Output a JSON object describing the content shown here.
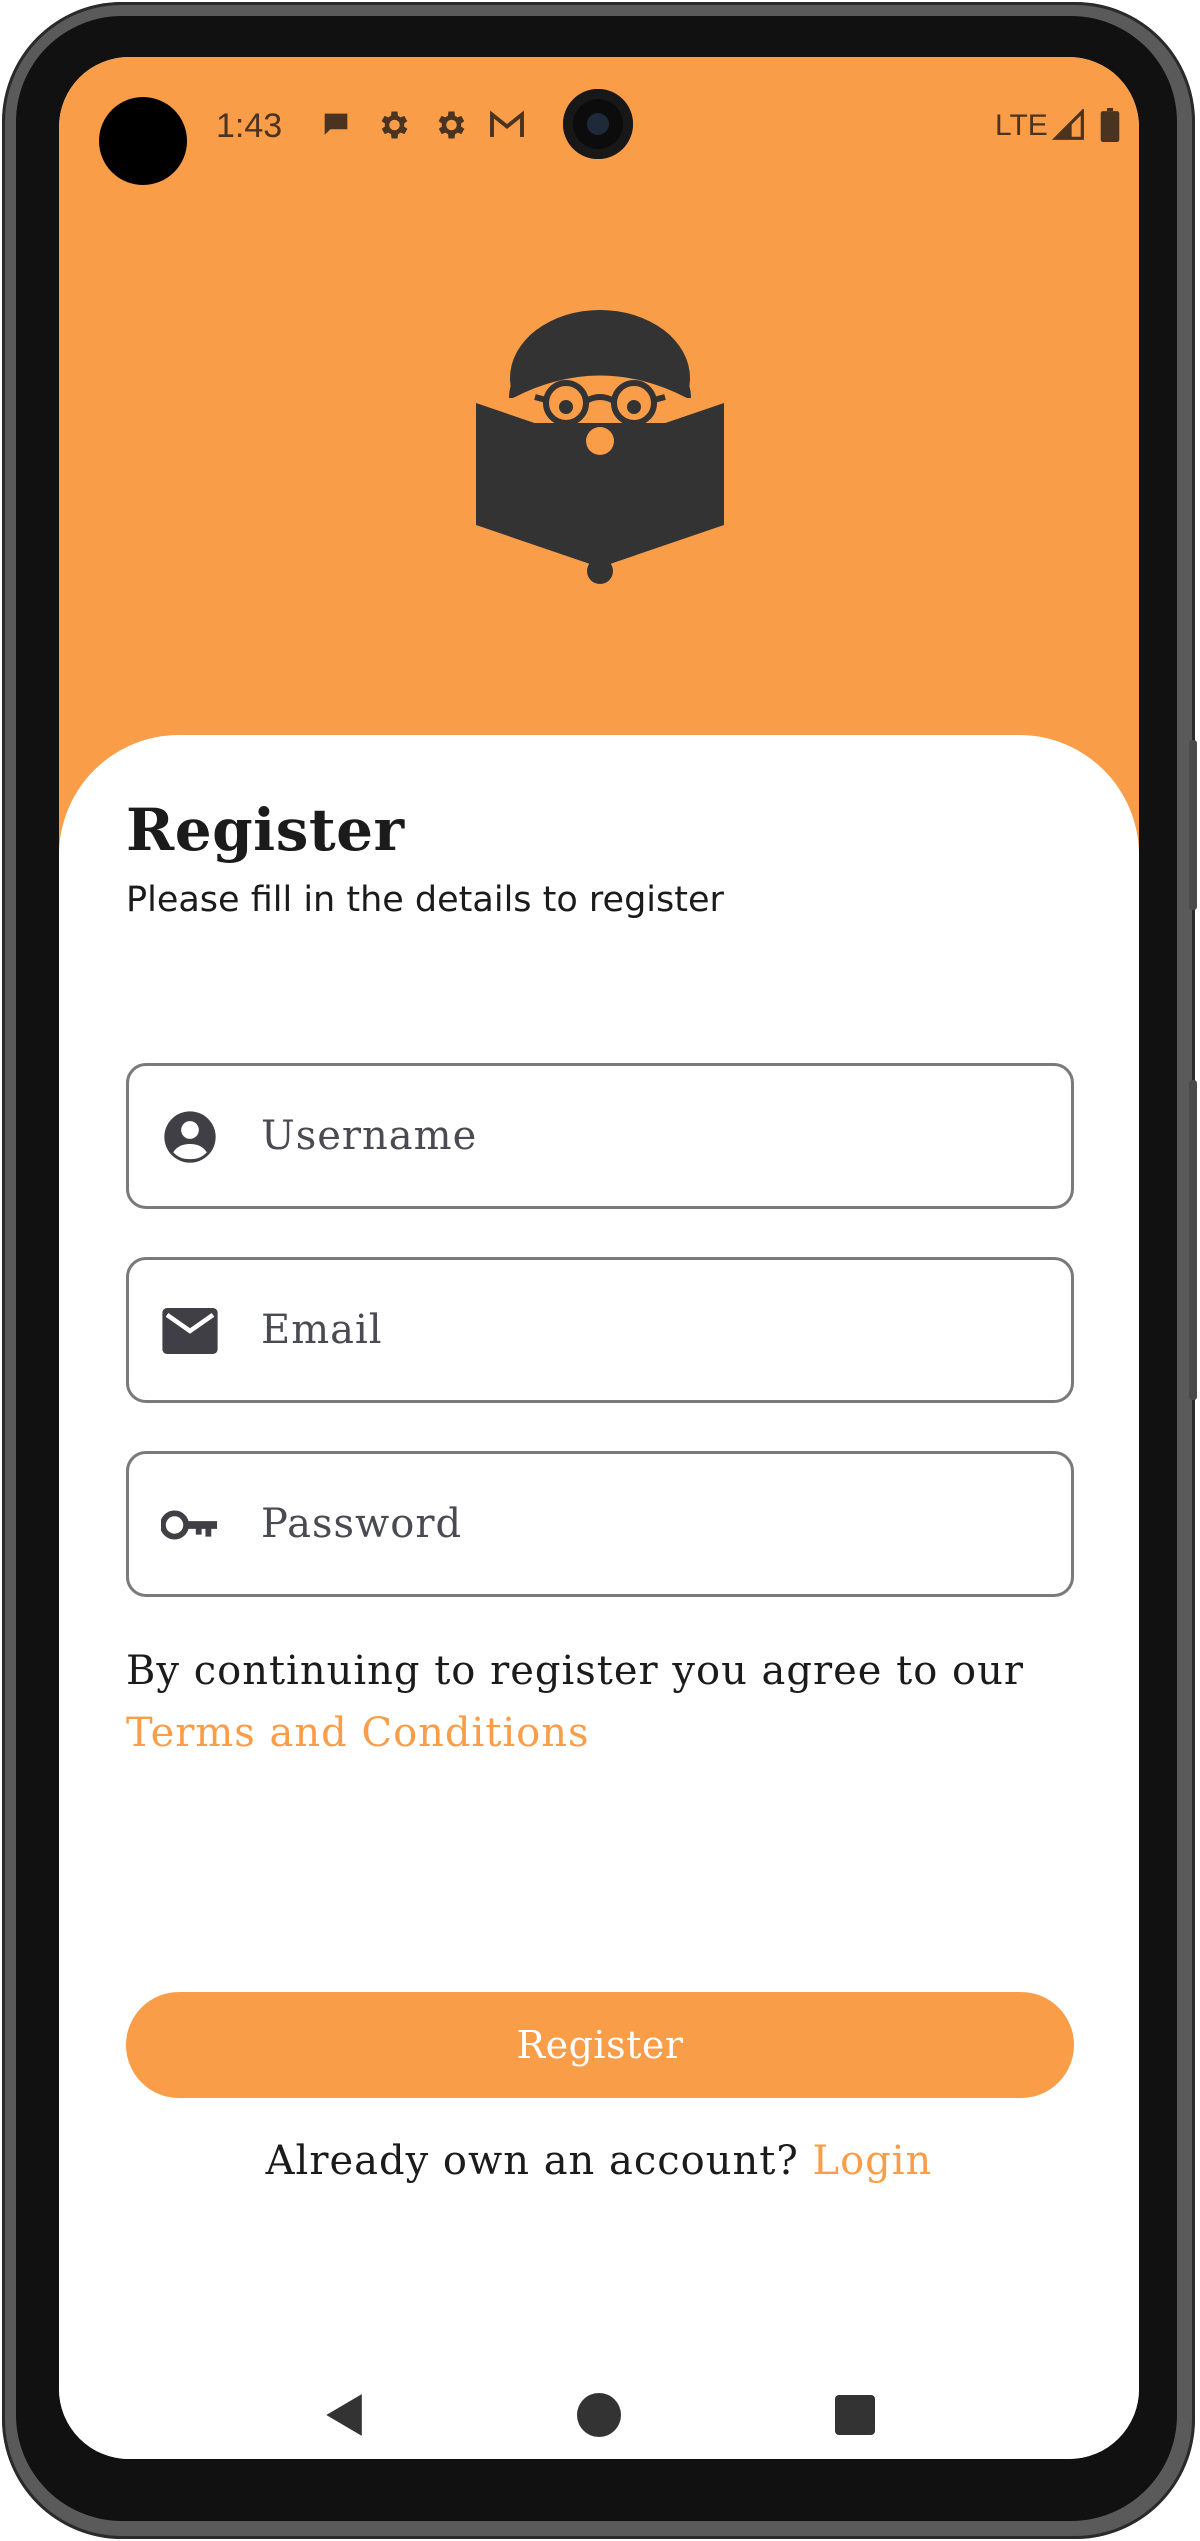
{
  "status_bar": {
    "time": "1:43",
    "network": "LTE",
    "icons": [
      "chat-bubble-icon",
      "gear-icon",
      "gear-icon",
      "gmail-icon",
      "signal-icon",
      "battery-icon"
    ]
  },
  "colors": {
    "accent": "#FA9D48",
    "icon_dark": "#333333",
    "text": "#1b1b1b"
  },
  "register": {
    "title": "Register",
    "subtitle": "Please fill in the details to register",
    "username_placeholder": "Username",
    "email_placeholder": "Email",
    "password_placeholder": "Password",
    "terms_text": "By continuing to register you agree to our",
    "terms_link": "Terms and Conditions",
    "button_label": "Register",
    "login_prompt": "Already own an account?",
    "login_link": "Login"
  },
  "nav": {
    "icons": [
      "back-icon",
      "home-icon",
      "recents-icon"
    ]
  }
}
